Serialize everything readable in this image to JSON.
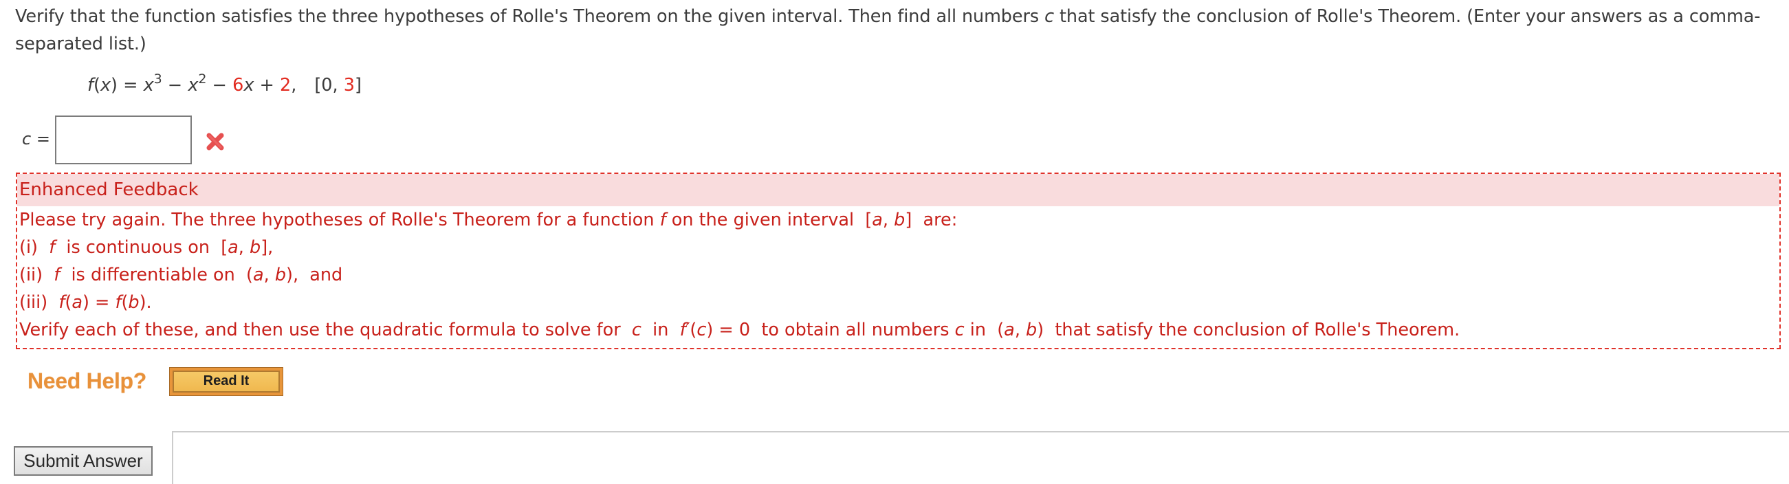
{
  "question": {
    "text_part1": "Verify that the function satisfies the three hypotheses of Rolle's Theorem on the given interval. Then find all numbers ",
    "var_c": "c",
    "text_part2": " that satisfy the conclusion of Rolle's Theorem. (Enter your answers as a comma-separated list.)"
  },
  "formula": {
    "fx": "f",
    "open": "(",
    "x": "x",
    "close": ")",
    "equals": " = ",
    "x3_base": "x",
    "x3_exp": "3",
    "minus1": " − ",
    "x2_base": "x",
    "x2_exp": "2",
    "minus2": " − ",
    "coef6": "6",
    "x_term": "x",
    "plus": " + ",
    "const2": "2",
    "comma": ",",
    "interval_open": "[0, ",
    "interval_end": "3",
    "interval_close": "]"
  },
  "answer": {
    "label_var": "c",
    "label_eq": " =",
    "value": "",
    "placeholder": "",
    "status_icon": "incorrect-x-icon",
    "status": "incorrect"
  },
  "feedback": {
    "header": "Enhanced Feedback",
    "lines": [
      {
        "p1": "Please try again. The three hypotheses of Rolle's Theorem for a function ",
        "f": "f",
        "p2": " on the given interval  [",
        "a": "a",
        "p3": ", ",
        "b": "b",
        "p4": "]  are:"
      },
      {
        "p1": "(i)  ",
        "f": "f",
        "p2": "  is continuous on  [",
        "a": "a",
        "p3": ", ",
        "b": "b",
        "p4": "],"
      },
      {
        "p1": "(ii)  ",
        "f": "f",
        "p2": "  is differentiable on  (",
        "a": "a",
        "p3": ", ",
        "b": "b",
        "p4": "),  and"
      },
      {
        "p1": "(iii)  ",
        "fa": "f",
        "p2": "(",
        "a": "a",
        "p3": ") = ",
        "fb": "f",
        "p4": "(",
        "b": "b",
        "p5": ")."
      },
      {
        "p1": "Verify each of these, and then use the quadratic formula to solve for  ",
        "c1": "c",
        "p2": "  in  ",
        "fprime": "f′",
        "p3": "(",
        "c2": "c",
        "p4": ") = 0  to obtain all numbers ",
        "c3": "c",
        "p5": " in  (",
        "a": "a",
        "p6": ", ",
        "b": "b",
        "p7": ")  that satisfy the conclusion of Rolle's Theorem."
      }
    ]
  },
  "help": {
    "label": "Need Help?",
    "read_it": "Read It"
  },
  "submit": {
    "label": "Submit Answer"
  },
  "colors": {
    "text": "#3c3c3c",
    "highlight_red": "#e22a1f",
    "feedback_red": "#c8211b",
    "feedback_bg": "#f9dcdd",
    "help_orange": "#e8913a",
    "read_it_gold": "#f2be5a"
  }
}
